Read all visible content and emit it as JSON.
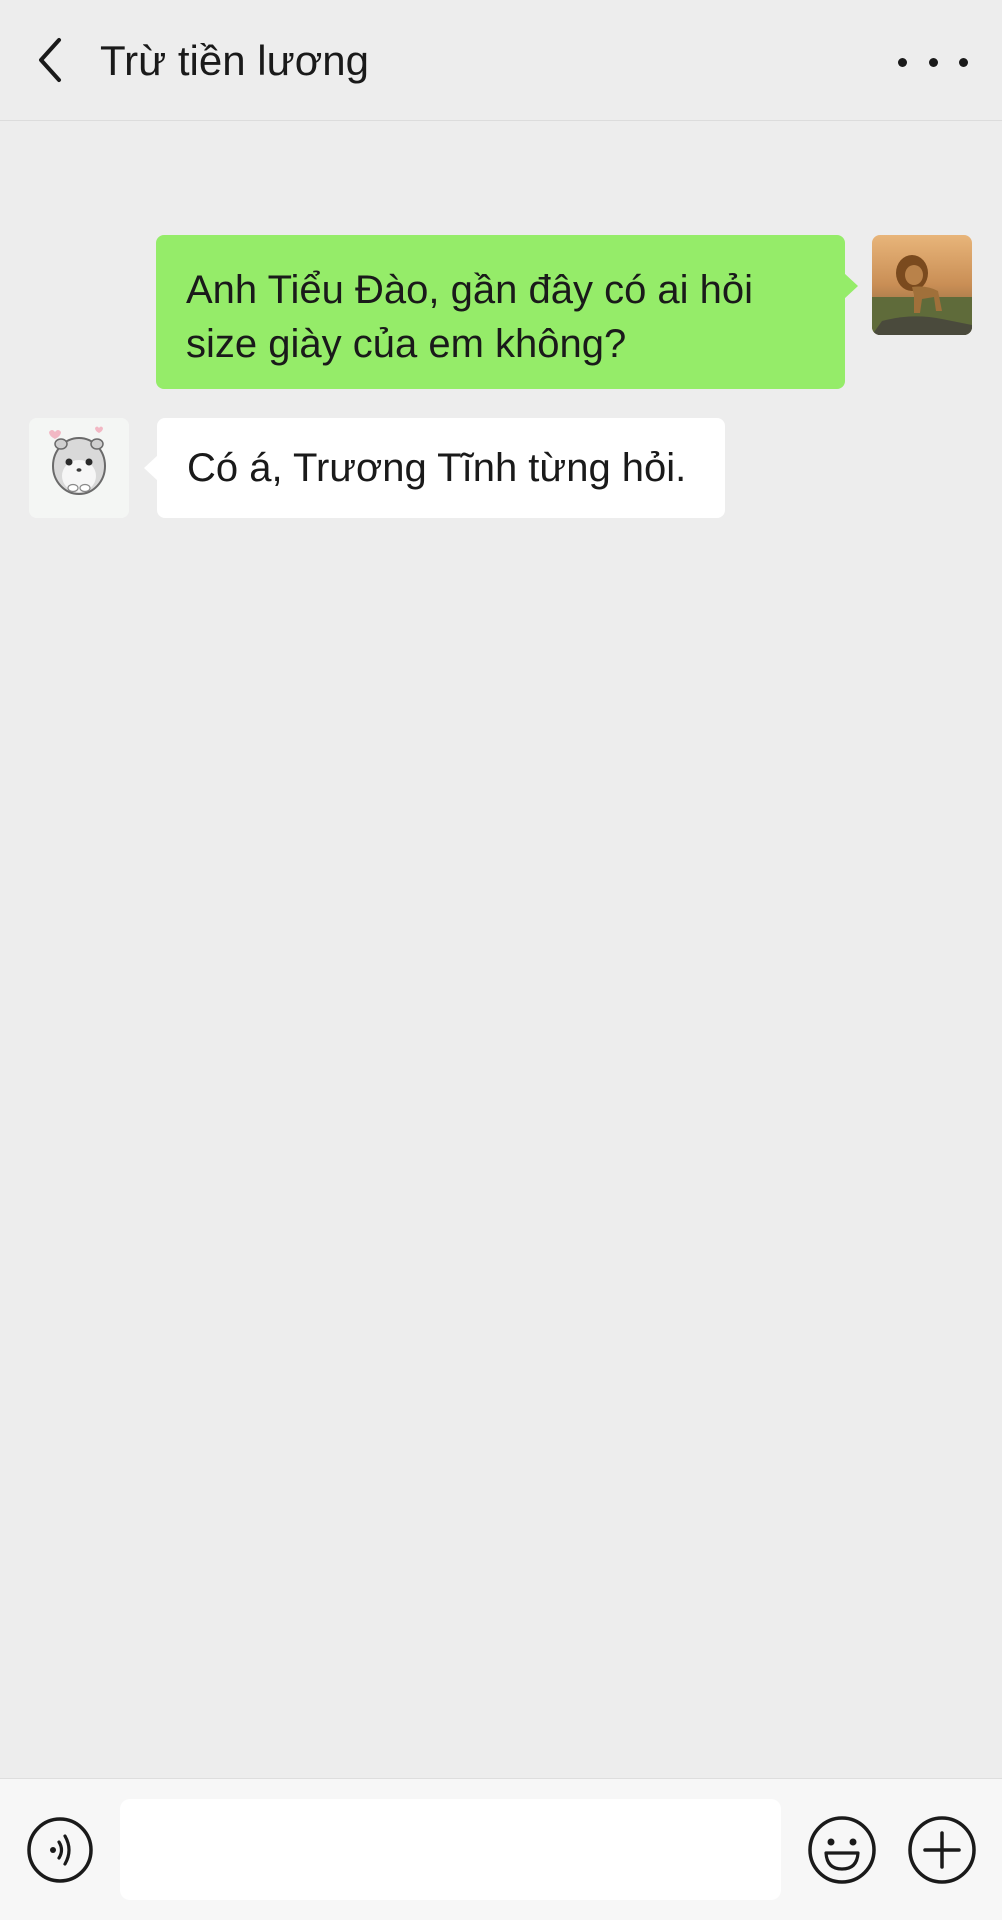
{
  "header": {
    "title": "Trừ tiền lương",
    "back_icon": "chevron-left-icon",
    "more_icon": "more-dots-icon"
  },
  "messages": [
    {
      "direction": "sent",
      "text": "Anh Tiểu Đào, gần đây có ai hỏi size giày của em không?",
      "avatar": "lion-avatar"
    },
    {
      "direction": "received",
      "text": "Có á, Trương Tĩnh từng hỏi.",
      "avatar": "hamster-avatar"
    }
  ],
  "input_bar": {
    "voice_icon": "voice-icon",
    "message_value": "",
    "emoji_icon": "emoji-icon",
    "plus_icon": "plus-icon"
  },
  "colors": {
    "background": "#ededed",
    "sent_bubble": "#95ec69",
    "received_bubble": "#ffffff",
    "input_bar": "#f7f7f7"
  }
}
